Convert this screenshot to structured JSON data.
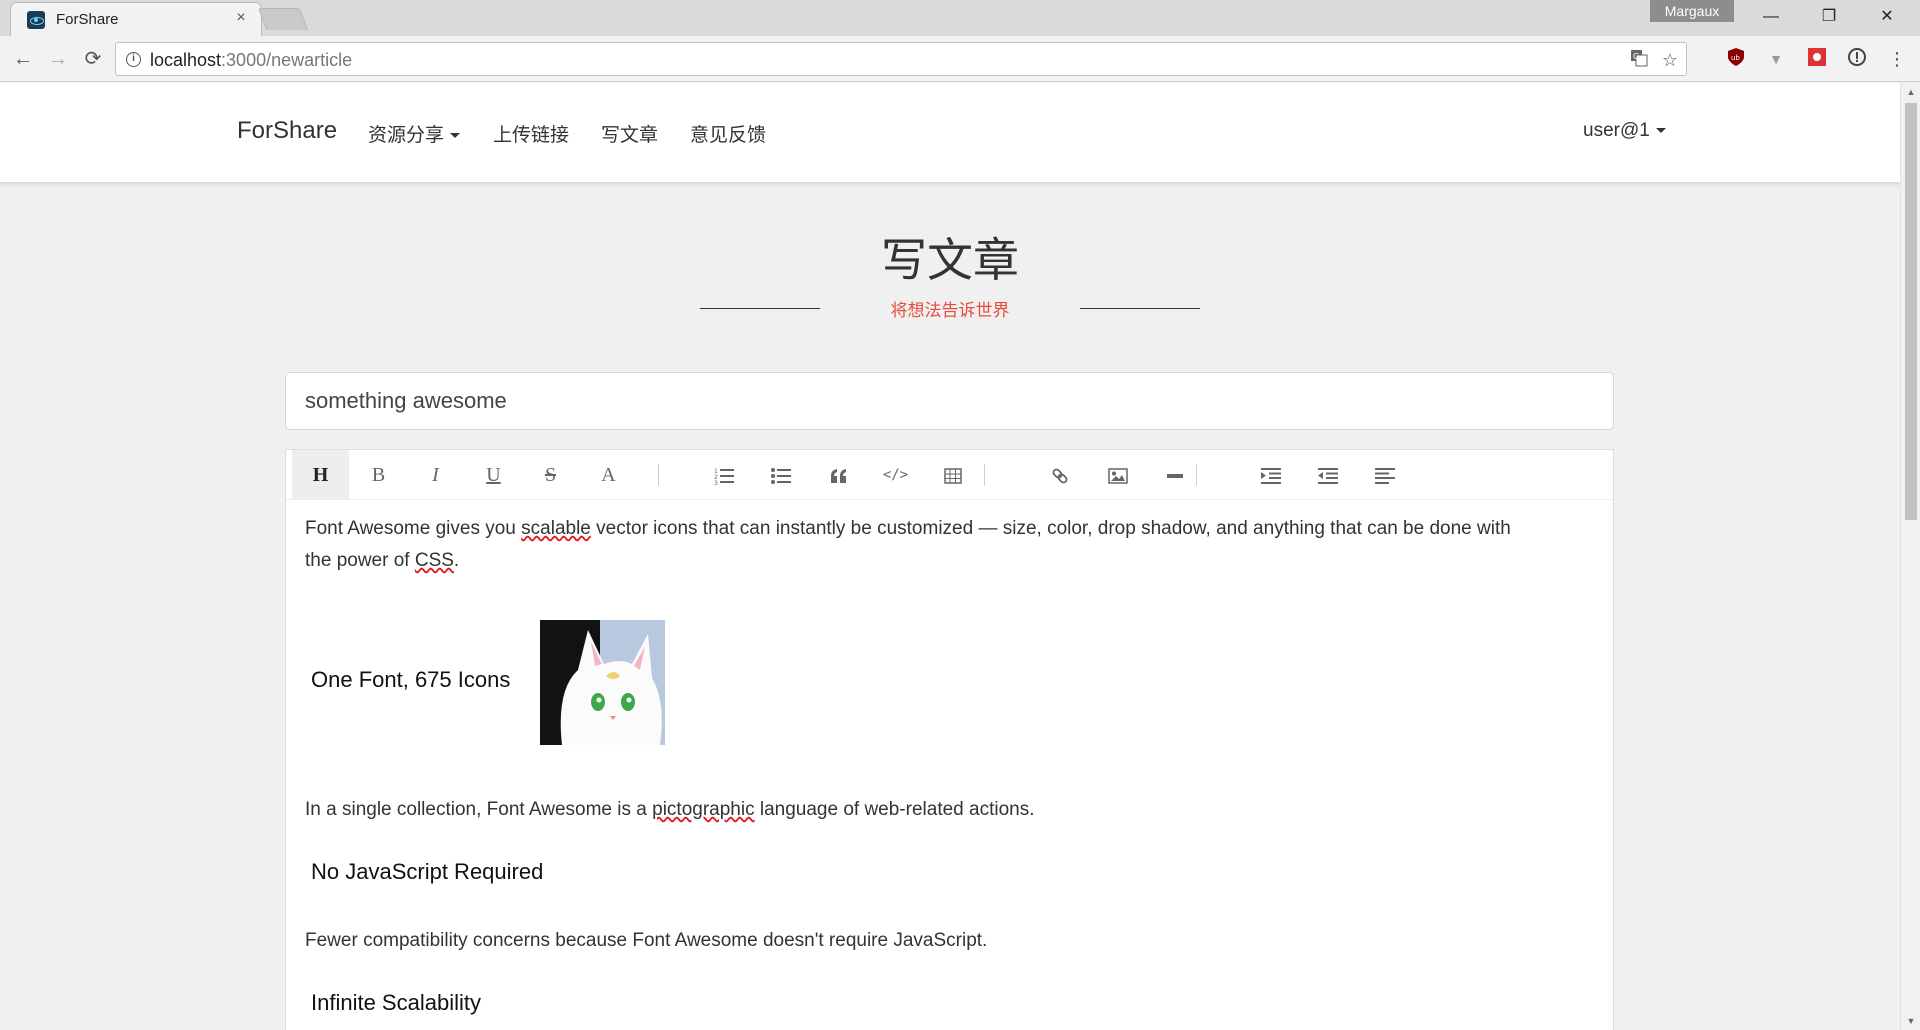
{
  "browser": {
    "tab_title": "ForShare",
    "tab_close": "×",
    "profile_name": "Margaux",
    "url_host": "localhost",
    "url_path": ":3000/newarticle",
    "window_minimize": "—",
    "window_restore": "❐",
    "window_close": "✕"
  },
  "site_nav": {
    "brand": "ForShare",
    "items": [
      {
        "label": "资源分享",
        "has_caret": true
      },
      {
        "label": "上传链接"
      },
      {
        "label": "写文章"
      },
      {
        "label": "意见反馈"
      }
    ],
    "user": "user@1"
  },
  "header": {
    "title": "写文章",
    "subtitle": "将想法告诉世界"
  },
  "article": {
    "title_value": "something awesome"
  },
  "editor": {
    "toolbar": {
      "heading": "H",
      "bold": "B",
      "italic": "I",
      "underline": "U",
      "strike": "S",
      "font_color": "A"
    },
    "content": {
      "p1_a": "Font Awesome gives you ",
      "p1_b": "scalable",
      "p1_c": " vector icons that can instantly be customized — size, color, drop shadow, and anything that can be done with",
      "p1_d": "the power of ",
      "p1_e": "CSS",
      "p1_f": ".",
      "h1": "One Font, 675 Icons",
      "p2_a": "In a single collection, Font Awesome is a ",
      "p2_b": "pictographic",
      "p2_c": " language of web-related actions.",
      "h2": "No JavaScript Required",
      "p3": "Fewer compatibility concerns because Font Awesome doesn't require JavaScript.",
      "h3": "Infinite Scalability"
    }
  },
  "colors": {
    "accent_red": "#e74c3c",
    "page_bg": "#f0f0f0"
  }
}
